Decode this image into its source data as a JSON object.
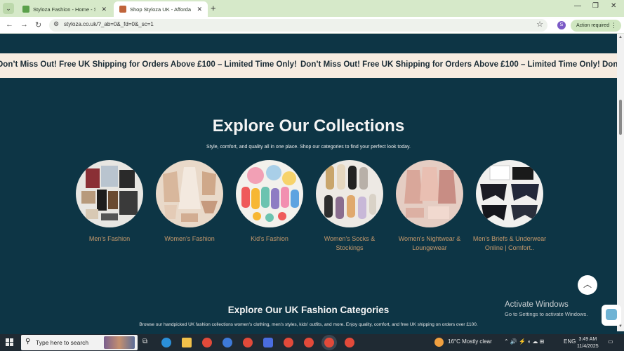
{
  "browser": {
    "tabs": [
      {
        "title": "Styloza Fashion - Home - Shopify",
        "active": false,
        "favicon_color": "#5aa04a"
      },
      {
        "title": "Shop Styloza UK - Affordable Fashion",
        "active": true,
        "favicon_color": "#c0643a"
      }
    ],
    "tab_close": "✕",
    "new_tab": "+",
    "minimize": "—",
    "maximize": "❐",
    "close": "✕",
    "url": "styloza.co.uk/?_ab=0&_fd=0&_sc=1",
    "profile_initial": "S",
    "action_required": "Action required"
  },
  "announcement": "Don’t Miss Out! Free UK Shipping for Orders Above £100 – Limited Time Only!",
  "collections": {
    "title": "Explore Our Collections",
    "subtitle": "Style, comfort, and quality all in one place. Shop our categories to find your perfect look today.",
    "items": [
      {
        "label": "Men's Fashion"
      },
      {
        "label": "Women's Fashion"
      },
      {
        "label": "Kid's Fashion"
      },
      {
        "label": "Women's Socks & Stockings"
      },
      {
        "label": "Women's Nightwear & Loungewear"
      },
      {
        "label": "Men's Briefs & Underwear Online | Comfort.."
      }
    ]
  },
  "uk_categories": {
    "title": "Explore Our UK Fashion Categories",
    "subtitle": "Browse our handpicked UK fashion collections women's clothing, men's styles, kids' outfits, and more. Enjoy quality, comfort, and free UK shipping on orders over £100."
  },
  "watermark": {
    "line1": "Activate Windows",
    "line2": "Go to Settings to activate Windows."
  },
  "taskbar": {
    "search_placeholder": "Type here to search",
    "weather": "16°C  Mostly clear",
    "lang": "ENG",
    "time": "3:49 AM",
    "date": "11/4/2025"
  },
  "colors": {
    "page_bg": "#0d3545",
    "accent_label": "#c89a6c",
    "announcement_bg": "#f6ece1"
  }
}
